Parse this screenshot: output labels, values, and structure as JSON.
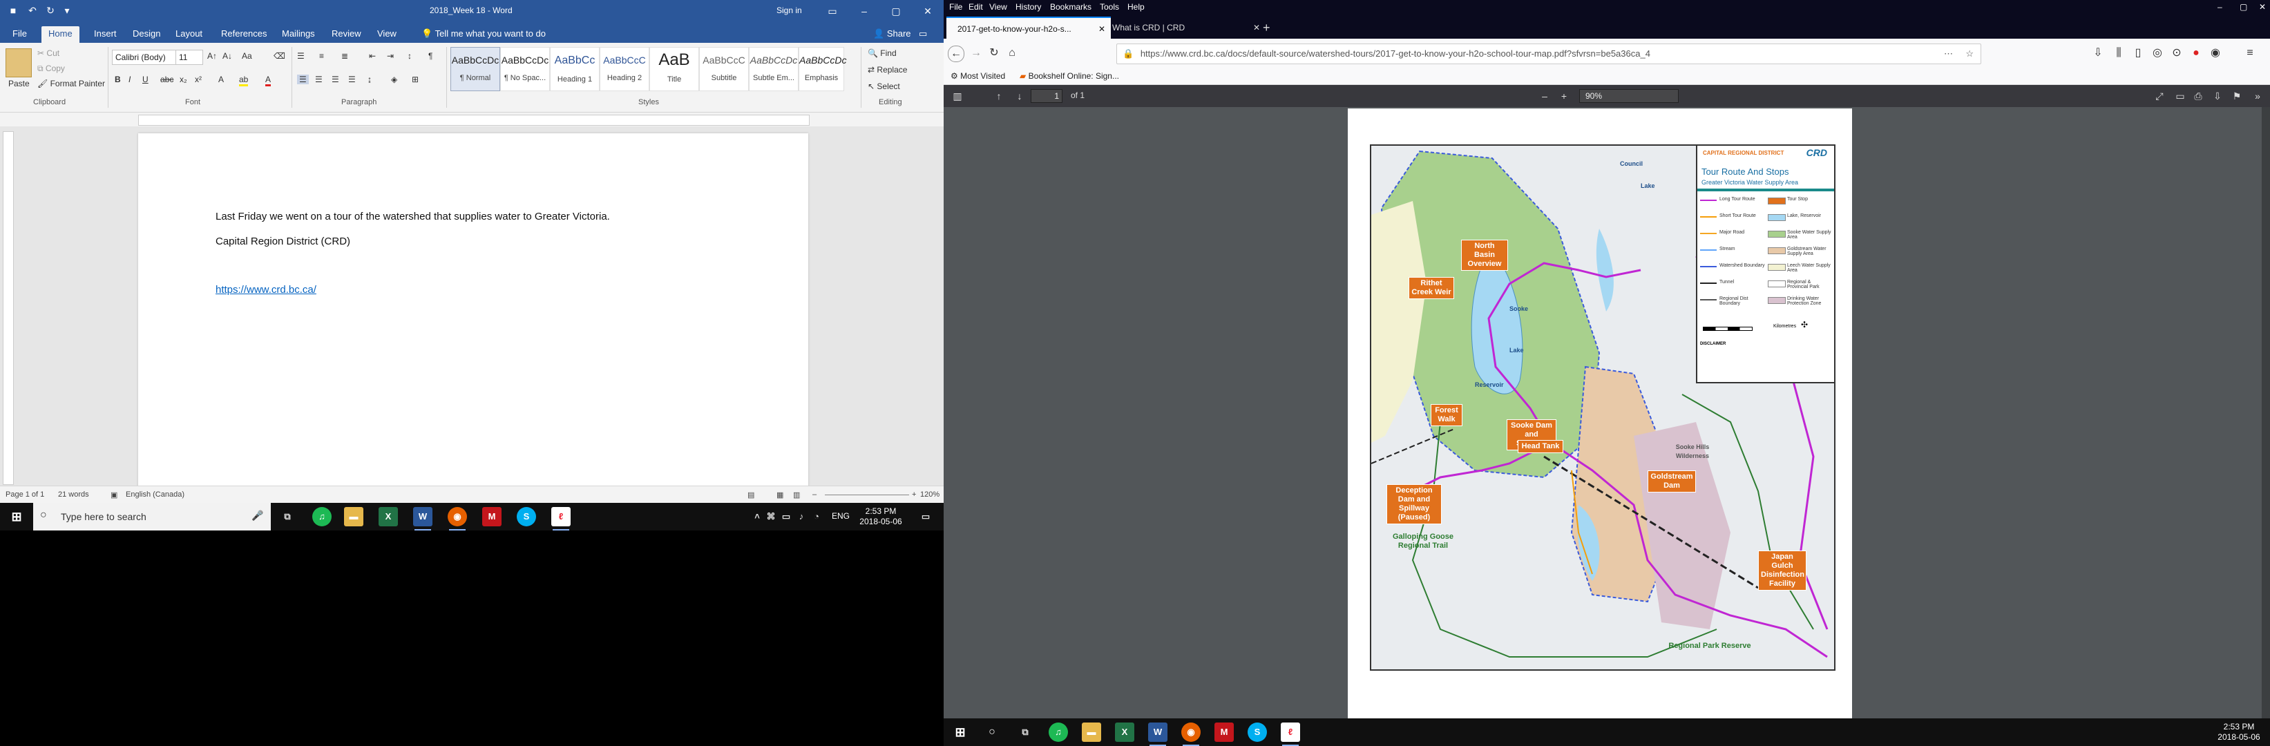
{
  "word": {
    "title": "2018_Week 18 - Word",
    "sign_in": "Sign in",
    "tabs": [
      "File",
      "Home",
      "Insert",
      "Design",
      "Layout",
      "References",
      "Mailings",
      "Review",
      "View"
    ],
    "tell_me": "Tell me what you want to do",
    "share": "Share",
    "clipboard": {
      "paste": "Paste",
      "cut": "Cut",
      "copy": "Copy",
      "format_painter": "Format Painter",
      "group": "Clipboard"
    },
    "font": {
      "name": "Calibri (Body)",
      "size": "11",
      "group": "Font"
    },
    "paragraph_group": "Paragraph",
    "styles": [
      {
        "preview": "AaBbCcDc",
        "name": "¶ Normal"
      },
      {
        "preview": "AaBbCcDc",
        "name": "¶ No Spac..."
      },
      {
        "preview": "AaBbCc",
        "name": "Heading 1"
      },
      {
        "preview": "AaBbCcC",
        "name": "Heading 2"
      },
      {
        "preview": "AaB",
        "name": "Title"
      },
      {
        "preview": "AaBbCcC",
        "name": "Subtitle"
      },
      {
        "preview": "AaBbCcDc",
        "name": "Subtle Em..."
      },
      {
        "preview": "AaBbCcDc",
        "name": "Emphasis"
      }
    ],
    "styles_group": "Styles",
    "editing": {
      "find": "Find",
      "replace": "Replace",
      "select": "Select",
      "group": "Editing"
    },
    "document": {
      "line1": "Last Friday we went on a tour of the watershed that supplies water to Greater Victoria.",
      "line2": "Capital Region District (CRD)",
      "link": "https://www.crd.bc.ca/"
    },
    "status": {
      "page": "Page 1 of 1",
      "words": "21 words",
      "language": "English (Canada)",
      "zoom": "120%"
    }
  },
  "taskbar_left": {
    "search_placeholder": "Type here to search",
    "lang": "ENG",
    "time": "2:53 PM",
    "date": "2018-05-06"
  },
  "firefox": {
    "menu": [
      "File",
      "Edit",
      "View",
      "History",
      "Bookmarks",
      "Tools",
      "Help"
    ],
    "tabs": [
      {
        "label": "2017-get-to-know-your-h2o-s..."
      },
      {
        "label": "What is CRD | CRD"
      }
    ],
    "url": "https://www.crd.bc.ca/docs/default-source/watershed-tours/2017-get-to-know-your-h2o-school-tour-map.pdf?sfvrsn=be5a36ca_4",
    "bookmarks": [
      "Most Visited",
      "Bookshelf Online: Sign..."
    ],
    "pdf": {
      "page": "1",
      "of": "of 1",
      "zoom": "90%"
    }
  },
  "map": {
    "header_small": "CAPITAL REGIONAL DISTRICT",
    "logo": "CRD",
    "title": "Tour Route And Stops",
    "subtitle": "Greater Victoria Water Supply Area",
    "legend": [
      {
        "label": "Long Tour Route",
        "color": "#c026d3"
      },
      {
        "label": "Short Tour Route",
        "color": "#f59e0b"
      },
      {
        "label": "Major Road",
        "color": "#f5a623"
      },
      {
        "label": "Stream",
        "color": "#60a5fa"
      },
      {
        "label": "Watershed Boundary",
        "color": "#3b5bdb"
      },
      {
        "label": "Tunnel",
        "color": "#222222"
      },
      {
        "label": "Regional Dist Boundary",
        "color": "#555555"
      },
      {
        "label": "Tour Stop",
        "color": "#e1711c"
      },
      {
        "label": "Lake, Reservoir",
        "color": "#a5d8f3"
      },
      {
        "label": "Sooke Water Supply Area",
        "color": "#a8d08d"
      },
      {
        "label": "Goldstream Water Supply Area",
        "color": "#e8c9a8"
      },
      {
        "label": "Leech Water Supply Area",
        "color": "#f3f2d2"
      },
      {
        "label": "Regional & Provincial Park",
        "color": "#ffffff"
      },
      {
        "label": "Drinking Water Protection Zone",
        "color": "#d9c2cf"
      }
    ],
    "scale": "Kilometres",
    "disclaimer": "DISCLAIMER",
    "stops": [
      "North Basin Overview",
      "Rithet Creek Weir",
      "Forest Walk",
      "Sooke Dam and Spillway",
      "Head Tank",
      "Goldstream Dam",
      "Deception Dam and Spillway (Paused)",
      "Japan Gulch Disinfection Facility"
    ],
    "green_labels": [
      "Galloping Goose Regional Trail",
      "Regional Park Reserve",
      "Sooke Hills Wilderness"
    ],
    "place_labels": [
      "Sooke",
      "Lake",
      "Reservoir",
      "Council",
      "Lake"
    ]
  },
  "taskbar_right": {
    "time": "2:53 PM",
    "date": "2018-05-06"
  }
}
